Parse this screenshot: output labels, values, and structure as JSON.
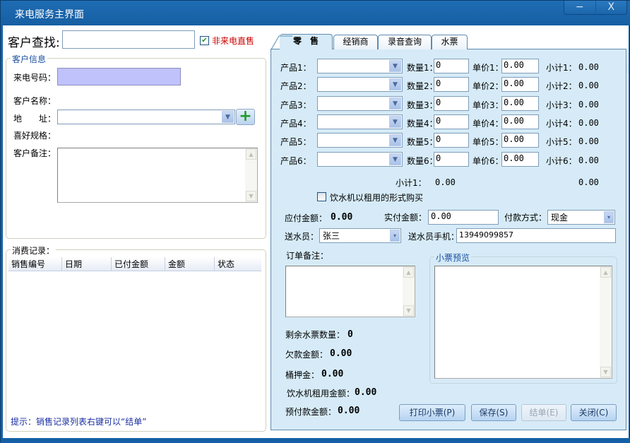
{
  "window": {
    "title": "来电服务主界面",
    "minimize": "−",
    "close": "X"
  },
  "search": {
    "label": "客户查找:",
    "value": "",
    "checkbox_label": "非来电直售",
    "checkbox_checked": true
  },
  "customer_info": {
    "group_title": "客户信息",
    "phone_label": "来电号码：",
    "phone_value": "",
    "name_label": "客户名称：",
    "name_value": "",
    "address_label": "地　　址：",
    "address_value": "",
    "pref_label": "喜好规格：",
    "pref_value": "",
    "remark_label": "客户备注：",
    "remark_value": ""
  },
  "records": {
    "group_title": "消费记录：",
    "columns": [
      "销售编号",
      "日期",
      "已付金额",
      "金额",
      "状态"
    ],
    "rows": [],
    "hint": "提示：销售记录列表右键可以“结单”"
  },
  "tabs": [
    {
      "label": "零　售",
      "active": true
    },
    {
      "label": "经销商",
      "active": false
    },
    {
      "label": "录音查询",
      "active": false
    },
    {
      "label": "水票",
      "active": false
    }
  ],
  "products": [
    {
      "label": "产品1：",
      "value": "",
      "qty_label": "数量1：",
      "qty": "0",
      "price_label": "单价1：",
      "price": "0.00",
      "sub_label": "小计1：",
      "sub": "0.00"
    },
    {
      "label": "产品2：",
      "value": "",
      "qty_label": "数量2：",
      "qty": "0",
      "price_label": "单价2：",
      "price": "0.00",
      "sub_label": "小计2：",
      "sub": "0.00"
    },
    {
      "label": "产品3：",
      "value": "",
      "qty_label": "数量3：",
      "qty": "0",
      "price_label": "单价3：",
      "price": "0.00",
      "sub_label": "小计3：",
      "sub": "0.00"
    },
    {
      "label": "产品4：",
      "value": "",
      "qty_label": "数量4：",
      "qty": "0",
      "price_label": "单价4：",
      "price": "0.00",
      "sub_label": "小计4：",
      "sub": "0.00"
    },
    {
      "label": "产品5：",
      "value": "",
      "qty_label": "数量5：",
      "qty": "0",
      "price_label": "单价5：",
      "price": "0.00",
      "sub_label": "小计5：",
      "sub": "0.00"
    },
    {
      "label": "产品6：",
      "value": "",
      "qty_label": "数量6：",
      "qty": "0",
      "price_label": "单价6：",
      "price": "0.00",
      "sub_label": "小计6：",
      "sub": "0.00"
    }
  ],
  "totals": {
    "subtotal_label": "小计1：",
    "subtotal_value": "0.00",
    "total_value": "0.00"
  },
  "rental": {
    "label": "饮水机以租用的形式购买",
    "checked": false
  },
  "payment": {
    "due_label": "应付金额：",
    "due_value": "0.00",
    "paid_label": "实付金额：",
    "paid_value": "0.00",
    "method_label": "付款方式：",
    "method_value": "现金",
    "courier_label": "送水员：",
    "courier_value": "张三",
    "courier_phone_label": "送水员手机：",
    "courier_phone_value": "13949099857"
  },
  "order_remark": {
    "label": "订单备注：",
    "value": ""
  },
  "receipt_preview": {
    "title": "小票预览",
    "content": ""
  },
  "stats": [
    {
      "label": "剩余水票数量：",
      "value": "0"
    },
    {
      "label": "欠款金额：",
      "value": "0.00"
    },
    {
      "label": "桶押金：",
      "value": "0.00"
    },
    {
      "label": "饮水机租用金额：",
      "value": "0.00"
    },
    {
      "label": "预付款金额：",
      "value": "0.00"
    }
  ],
  "buttons": {
    "print": "打印小票(P)",
    "save": "保存(S)",
    "settle": "结单(E)",
    "close": "关闭(C)"
  },
  "colors": {
    "title_bar": "#1560a6",
    "panel_bg": "#d6ebf7",
    "phone_field": "#c0c2fb",
    "hint_text": "#1a2fa0",
    "checkbox_label": "#cc0000",
    "group_title": "#1a4fa0"
  }
}
